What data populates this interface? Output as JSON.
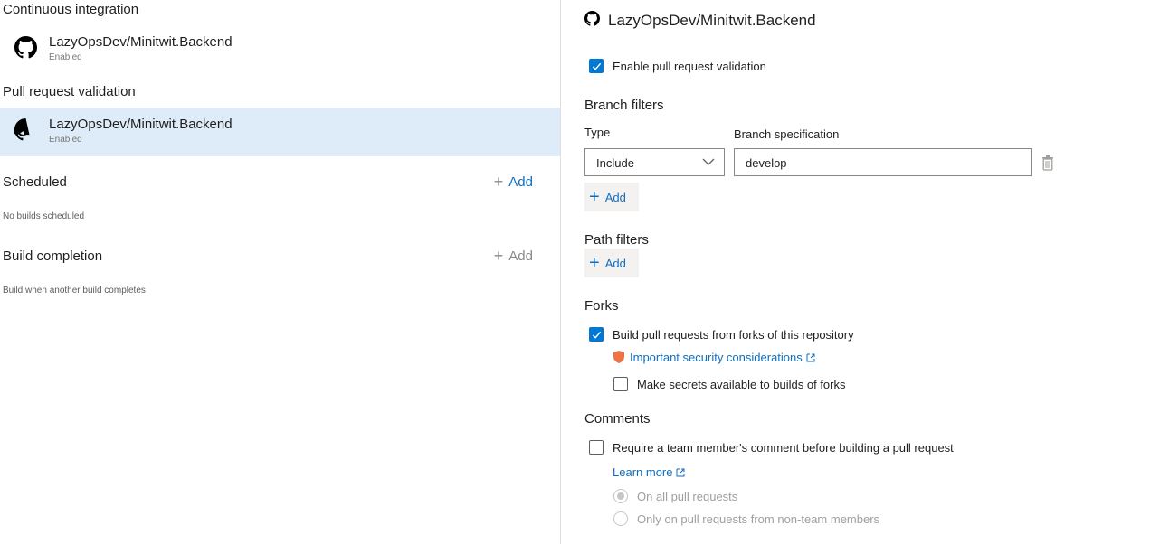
{
  "left": {
    "ci_title": "Continuous integration",
    "ci_repo": {
      "name": "LazyOpsDev/Minitwit.Backend",
      "status": "Enabled"
    },
    "pr_title": "Pull request validation",
    "pr_repo": {
      "name": "LazyOpsDev/Minitwit.Backend",
      "status": "Enabled"
    },
    "scheduled_title": "Scheduled",
    "scheduled_add": "Add",
    "scheduled_hint": "No builds scheduled",
    "completion_title": "Build completion",
    "completion_add": "Add",
    "completion_hint": "Build when another build completes"
  },
  "right": {
    "repo_title": "LazyOpsDev/Minitwit.Backend",
    "enable_pr_label": "Enable pull request validation",
    "enable_pr_checked": true,
    "branch_filters_title": "Branch filters",
    "type_label": "Type",
    "branch_spec_label": "Branch specification",
    "type_value": "Include",
    "branch_value": "develop",
    "branch_add": "Add",
    "path_filters_title": "Path filters",
    "path_add": "Add",
    "forks_title": "Forks",
    "forks_build_label": "Build pull requests from forks of this repository",
    "forks_build_checked": true,
    "security_link": "Important security considerations",
    "secrets_label": "Make secrets available to builds of forks",
    "secrets_checked": false,
    "comments_title": "Comments",
    "comments_require_label": "Require a team member's comment before building a pull request",
    "comments_require_checked": false,
    "learn_more": "Learn more",
    "radio_all": "On all pull requests",
    "radio_non_team": "Only on pull requests from non-team members"
  },
  "colors": {
    "accent": "#0078d4",
    "link": "#106ebe",
    "selected_bg": "#deecf9",
    "shield": "#e97548"
  },
  "icons": [
    "github-icon",
    "plus-icon",
    "chevron-down-icon",
    "trash-icon",
    "checkmark-icon",
    "shield-icon",
    "external-link-icon"
  ]
}
